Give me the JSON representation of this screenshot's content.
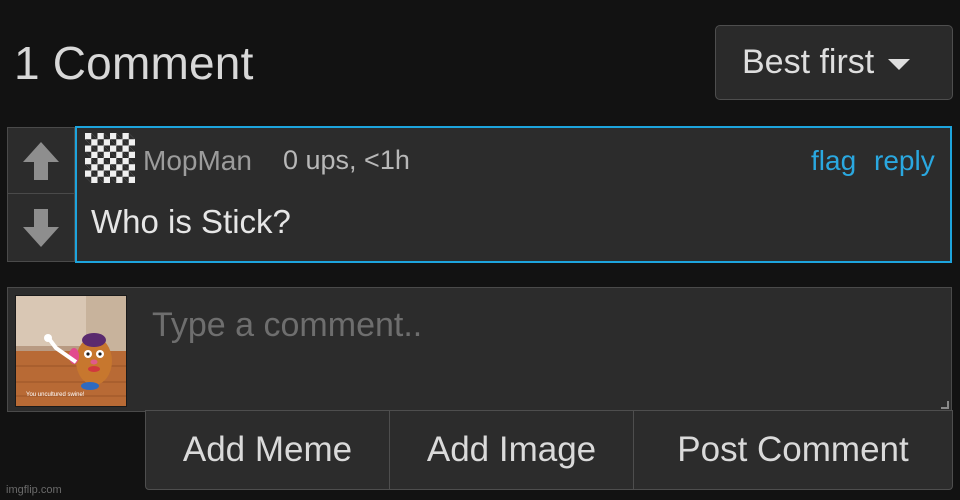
{
  "header": {
    "comment_count_title": "1 Comment",
    "sort_label": "Best first"
  },
  "comment": {
    "username": "MopMan",
    "meta": "0 ups, <1h",
    "flag_label": "flag",
    "reply_label": "reply",
    "text": "Who is Stick?"
  },
  "composer": {
    "placeholder": "Type a comment..",
    "avatar_caption": "You uncultured swine!",
    "buttons": {
      "add_meme": "Add Meme",
      "add_image": "Add Image",
      "post_comment": "Post Comment"
    }
  },
  "watermark": "imgflip.com",
  "colors": {
    "background": "#121212",
    "panel": "#2c2c2c",
    "accent_link": "#2aa8e0",
    "highlight_border": "#1da4dd"
  },
  "icons": {
    "upvote": "arrow-up-icon",
    "downvote": "arrow-down-icon",
    "sort": "caret-down-icon"
  }
}
